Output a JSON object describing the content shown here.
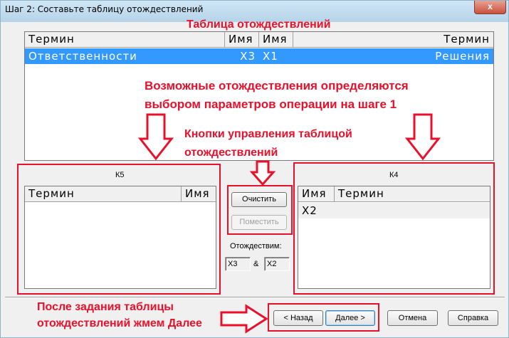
{
  "window": {
    "title": "Шаг 2: Составьте таблицу отождествлений",
    "close_glyph": "x"
  },
  "annotations": {
    "table_title": "Таблица отождествлений",
    "possible_line1": "Возможные отождествления определяются",
    "possible_line2": "выбором параметров операции на шаге 1",
    "buttons_line1": "Кнопки управления таблицой",
    "buttons_line2": "отождествлений",
    "after_line1": "После задания таблицы",
    "after_line2": "отождествлений жмем Далее",
    "color": "#e8102a"
  },
  "main_table": {
    "columns": [
      "Термин",
      "Имя",
      "Имя",
      "Термин"
    ],
    "rows": [
      {
        "term_left": "Ответственности",
        "name_left": "X3",
        "name_right": "X1",
        "term_right": "Решения",
        "selected": true
      }
    ]
  },
  "k5": {
    "label": "К5",
    "columns": [
      "Термин",
      "Имя"
    ],
    "rows": []
  },
  "k4": {
    "label": "К4",
    "columns": [
      "Имя",
      "Термин"
    ],
    "rows": [
      {
        "name": "X2",
        "term": ""
      }
    ]
  },
  "controls": {
    "clear_label": "Очистить",
    "place_label": "Поместить",
    "identify_label": "Отождествим:",
    "field_left": "X3",
    "ampersand": "&",
    "field_right": "X2"
  },
  "footer": {
    "back_label": "< Назад",
    "next_label": "Далее >",
    "cancel_label": "Отмена",
    "help_label": "Справка"
  },
  "colors": {
    "selection": "#3399ff",
    "annotation": "#e8102a"
  }
}
